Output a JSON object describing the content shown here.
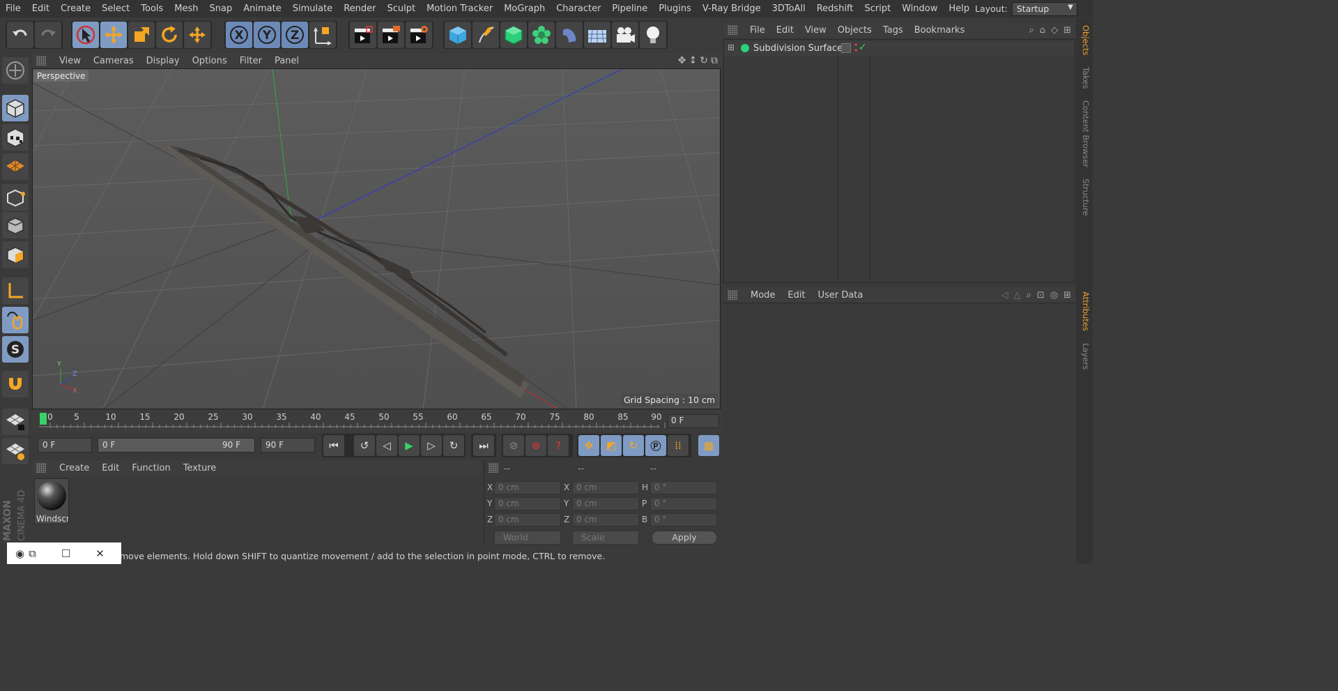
{
  "menu": [
    "File",
    "Edit",
    "Create",
    "Select",
    "Tools",
    "Mesh",
    "Snap",
    "Animate",
    "Simulate",
    "Render",
    "Sculpt",
    "Motion Tracker",
    "MoGraph",
    "Character",
    "Pipeline",
    "Plugins",
    "V-Ray Bridge",
    "3DToAll",
    "Redshift",
    "Script",
    "Window",
    "Help"
  ],
  "layout": {
    "label": "Layout:",
    "value": "Startup"
  },
  "viewport_menu": [
    "View",
    "Cameras",
    "Display",
    "Options",
    "Filter",
    "Panel"
  ],
  "viewport": {
    "label": "Perspective",
    "grid_spacing": "Grid Spacing : 10 cm",
    "axis_y": "Y",
    "axis_z": "Z",
    "axis_x": "X"
  },
  "timeline": {
    "ticks": [
      "0",
      "5",
      "10",
      "15",
      "20",
      "25",
      "30",
      "35",
      "40",
      "45",
      "50",
      "55",
      "60",
      "65",
      "70",
      "75",
      "80",
      "85",
      "90"
    ],
    "current_frame": "0 F"
  },
  "transport": {
    "start": "0 F",
    "range_start": "0 F",
    "range_end": "90 F",
    "end": "90 F"
  },
  "material_menu": [
    "Create",
    "Edit",
    "Function",
    "Texture"
  ],
  "material": {
    "name": "Windscr"
  },
  "coords": {
    "headers": [
      "--",
      "--",
      "--"
    ],
    "rows": [
      {
        "l1": "X",
        "v1": "0 cm",
        "l2": "X",
        "v2": "0 cm",
        "l3": "H",
        "v3": "0 °"
      },
      {
        "l1": "Y",
        "v1": "0 cm",
        "l2": "Y",
        "v2": "0 cm",
        "l3": "P",
        "v3": "0 °"
      },
      {
        "l1": "Z",
        "v1": "0 cm",
        "l2": "Z",
        "v2": "0 cm",
        "l3": "B",
        "v3": "0 °"
      }
    ],
    "mode_a": "World",
    "mode_b": "Scale",
    "apply": "Apply"
  },
  "status": "move elements. Hold down SHIFT to quantize movement / add to the selection in point mode, CTRL to remove.",
  "objects_menu": [
    "File",
    "Edit",
    "View",
    "Objects",
    "Tags",
    "Bookmarks"
  ],
  "objects": [
    {
      "name": "Subdivision Surface"
    }
  ],
  "attributes_menu": [
    "Mode",
    "Edit",
    "User Data"
  ],
  "side_tabs": [
    "Objects",
    "Takes",
    "Content Browser",
    "Structure",
    "Attributes",
    "Layers"
  ],
  "brand": {
    "line1": "MAXON",
    "line2": "CINEMA 4D"
  },
  "colors": {
    "accent_blue": "#7f9bc3",
    "active_tab": "#f0a030",
    "green_frame": "#3ad06a"
  }
}
